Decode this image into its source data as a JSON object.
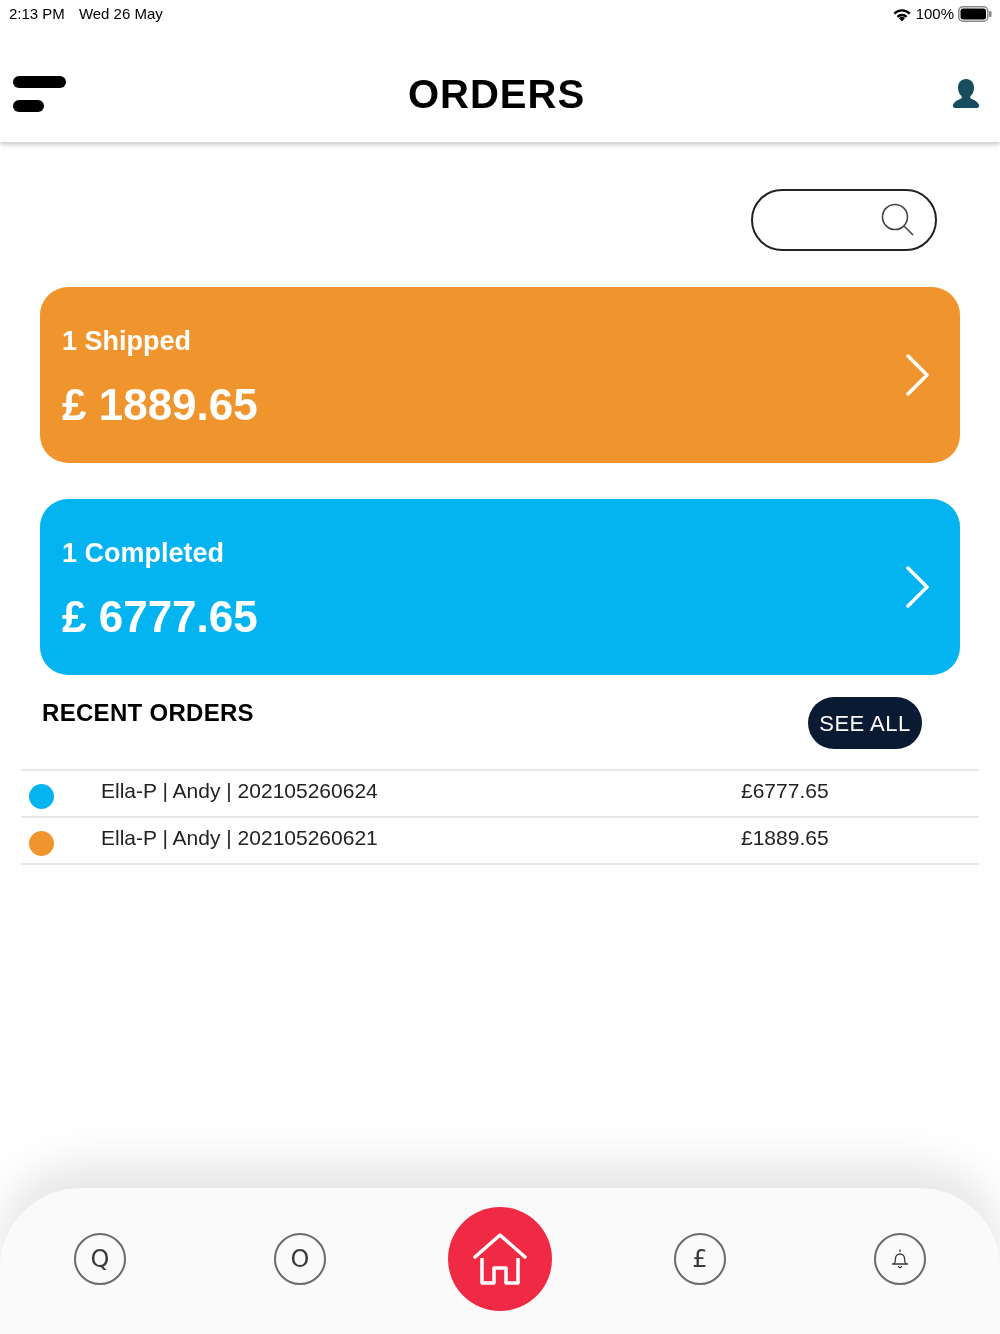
{
  "status_bar": {
    "time": "2:13 PM",
    "date": "Wed 26 May",
    "battery": "100%"
  },
  "header": {
    "title": "ORDERS"
  },
  "summary_cards": [
    {
      "color": "#f0952d",
      "label": "1 Shipped",
      "amount": "£ 1889.65"
    },
    {
      "color": "#04b4f0",
      "label": "1 Completed",
      "amount": "£ 6777.65"
    }
  ],
  "recent_orders": {
    "title": "RECENT ORDERS",
    "see_all": "SEE ALL",
    "rows": [
      {
        "color": "#04b4f0",
        "description": "Ella-P | Andy | 202105260624",
        "amount": "£6777.65"
      },
      {
        "color": "#f0952d",
        "description": "Ella-P | Andy | 202105260621",
        "amount": "£1889.65"
      }
    ]
  },
  "bottom_nav": [
    {
      "kind": "letter",
      "label": "Q",
      "selected": false
    },
    {
      "kind": "letter",
      "label": "O",
      "selected": false
    },
    {
      "kind": "home",
      "selected": true
    },
    {
      "kind": "letter",
      "label": "£",
      "selected": false
    },
    {
      "kind": "bell",
      "selected": false
    }
  ]
}
